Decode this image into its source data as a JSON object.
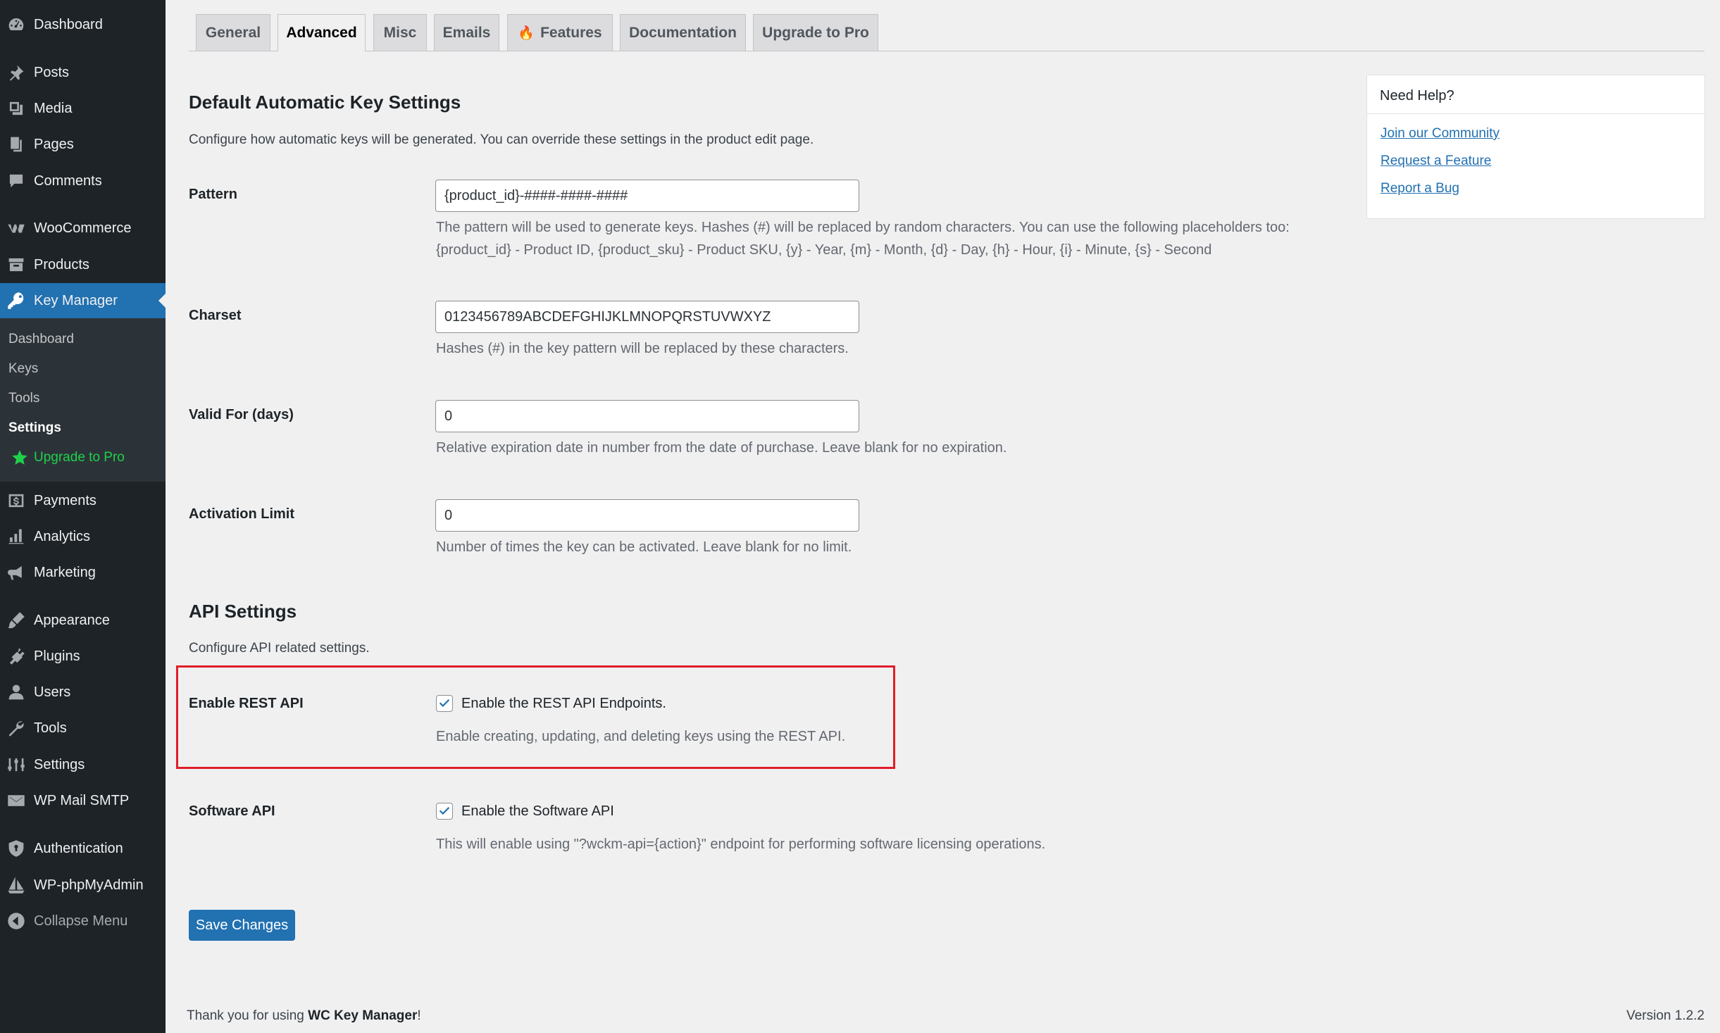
{
  "sidebar": {
    "items": [
      {
        "id": "dashboard",
        "label": "Dashboard",
        "icon": "dashboard-icon"
      },
      {
        "id": "posts",
        "label": "Posts",
        "icon": "pin-icon"
      },
      {
        "id": "media",
        "label": "Media",
        "icon": "media-icon"
      },
      {
        "id": "pages",
        "label": "Pages",
        "icon": "pages-icon"
      },
      {
        "id": "comments",
        "label": "Comments",
        "icon": "comment-icon"
      },
      {
        "id": "woocommerce",
        "label": "WooCommerce",
        "icon": "woo-icon"
      },
      {
        "id": "products",
        "label": "Products",
        "icon": "archive-icon"
      },
      {
        "id": "key-manager",
        "label": "Key Manager",
        "icon": "key-icon"
      },
      {
        "id": "payments",
        "label": "Payments",
        "icon": "dollar-icon"
      },
      {
        "id": "analytics",
        "label": "Analytics",
        "icon": "bar-chart-icon"
      },
      {
        "id": "marketing",
        "label": "Marketing",
        "icon": "megaphone-icon"
      },
      {
        "id": "appearance",
        "label": "Appearance",
        "icon": "brush-icon"
      },
      {
        "id": "plugins",
        "label": "Plugins",
        "icon": "plug-icon"
      },
      {
        "id": "users",
        "label": "Users",
        "icon": "user-icon"
      },
      {
        "id": "tools",
        "label": "Tools",
        "icon": "wrench-icon"
      },
      {
        "id": "settings",
        "label": "Settings",
        "icon": "settings-icon"
      },
      {
        "id": "wp-mail-smtp",
        "label": "WP Mail SMTP",
        "icon": "mail-icon"
      },
      {
        "id": "authentication",
        "label": "Authentication",
        "icon": "shield-icon"
      },
      {
        "id": "wp-phpmyadmin",
        "label": "WP-phpMyAdmin",
        "icon": "sailboat-icon"
      },
      {
        "id": "collapse",
        "label": "Collapse Menu",
        "icon": "collapse-icon"
      }
    ],
    "submenu": [
      "Dashboard",
      "Keys",
      "Tools",
      "Settings",
      "Upgrade to Pro"
    ]
  },
  "tabs": [
    "General",
    "Advanced",
    "Misc",
    "Emails",
    "Features",
    "Documentation",
    "Upgrade to Pro"
  ],
  "key_settings": {
    "title": "Default Automatic Key Settings",
    "description": "Configure how automatic keys will be generated. You can override these settings in the product edit page.",
    "pattern": {
      "label": "Pattern",
      "value": "{product_id}-####-####-####",
      "help_line1": "The pattern will be used to generate keys. Hashes (#) will be replaced by random characters. You can use the following placeholders too:",
      "help_line2": "{product_id} - Product ID, {product_sku} - Product SKU, {y} - Year, {m} - Month, {d} - Day, {h} - Hour, {i} - Minute, {s} - Second"
    },
    "charset": {
      "label": "Charset",
      "value": "0123456789ABCDEFGHIJKLMNOPQRSTUVWXYZ",
      "help": "Hashes (#) in the key pattern will be replaced by these characters."
    },
    "valid_for": {
      "label": "Valid For (days)",
      "value": "0",
      "help": "Relative expiration date in number from the date of purchase. Leave blank for no expiration."
    },
    "activation_limit": {
      "label": "Activation Limit",
      "value": "0",
      "help": "Number of times the key can be activated. Leave blank for no limit."
    }
  },
  "api_settings": {
    "title": "API Settings",
    "description": "Configure API related settings.",
    "rest_api": {
      "label": "Enable REST API",
      "checkbox_label": "Enable the REST API Endpoints.",
      "help": "Enable creating, updating, and deleting keys using the REST API."
    },
    "software_api": {
      "label": "Software API",
      "checkbox_label": "Enable the Software API",
      "help": "This will enable using \"?wckm-api={action}\" endpoint for performing software licensing operations."
    }
  },
  "save_label": "Save Changes",
  "help_box": {
    "title": "Need Help?",
    "links": [
      "Join our Community",
      "Request a Feature",
      "Report a Bug"
    ]
  },
  "footer": {
    "thanks_prefix": "Thank you for using ",
    "product_name": "WC Key Manager",
    "thanks_suffix": "!",
    "version": "Version 1.2.2"
  }
}
